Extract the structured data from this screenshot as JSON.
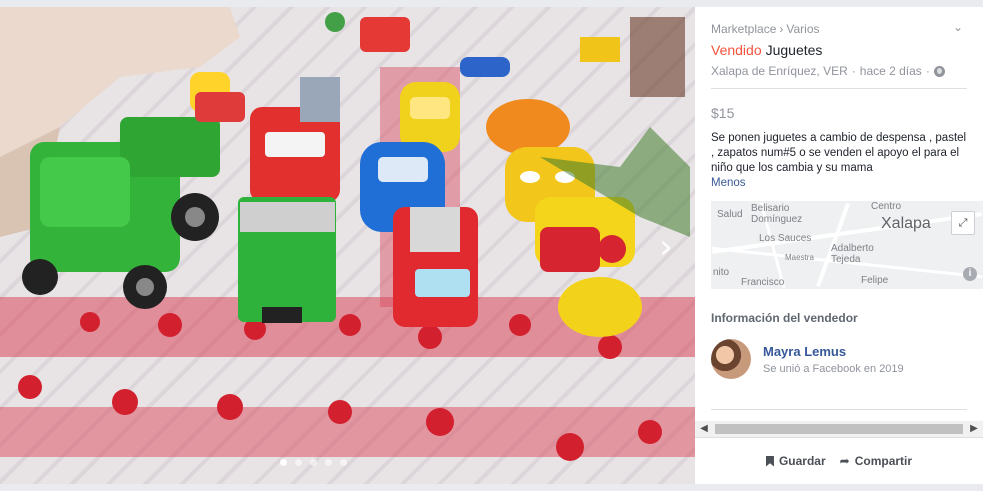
{
  "listing": {
    "breadcrumb": [
      "Marketplace",
      "Varios"
    ],
    "breadcrumb_sep": "›",
    "status": "Vendido",
    "title": "Juguetes",
    "location": "Xalapa de Enríquez, VER",
    "time": "hace 2 días",
    "loc_sep": "·",
    "price": "$15",
    "description": "Se ponen juguetes a cambio de despensa , pastel , zapatos num#5 o se venden  el apoyo el para el niño que los cambia   y su mama",
    "less_link": "Menos"
  },
  "map": {
    "city": "Xalapa",
    "labels": [
      "Salud",
      "Belisario Domínguez",
      "Centro",
      "Los Sauces",
      "Adalberto Tejeda",
      "Maestra",
      "nito",
      "Francisco",
      "Felipe"
    ]
  },
  "seller": {
    "heading": "Información del vendedor",
    "name": "Mayra Lemus",
    "joined": "Se unió a Facebook en 2019"
  },
  "actions": {
    "save": "Guardar",
    "share": "Compartir"
  },
  "carousel": {
    "dots": 5,
    "active": 0
  },
  "colors": {
    "sold": "#f5533d",
    "link": "#365899",
    "muted": "#90949c"
  }
}
